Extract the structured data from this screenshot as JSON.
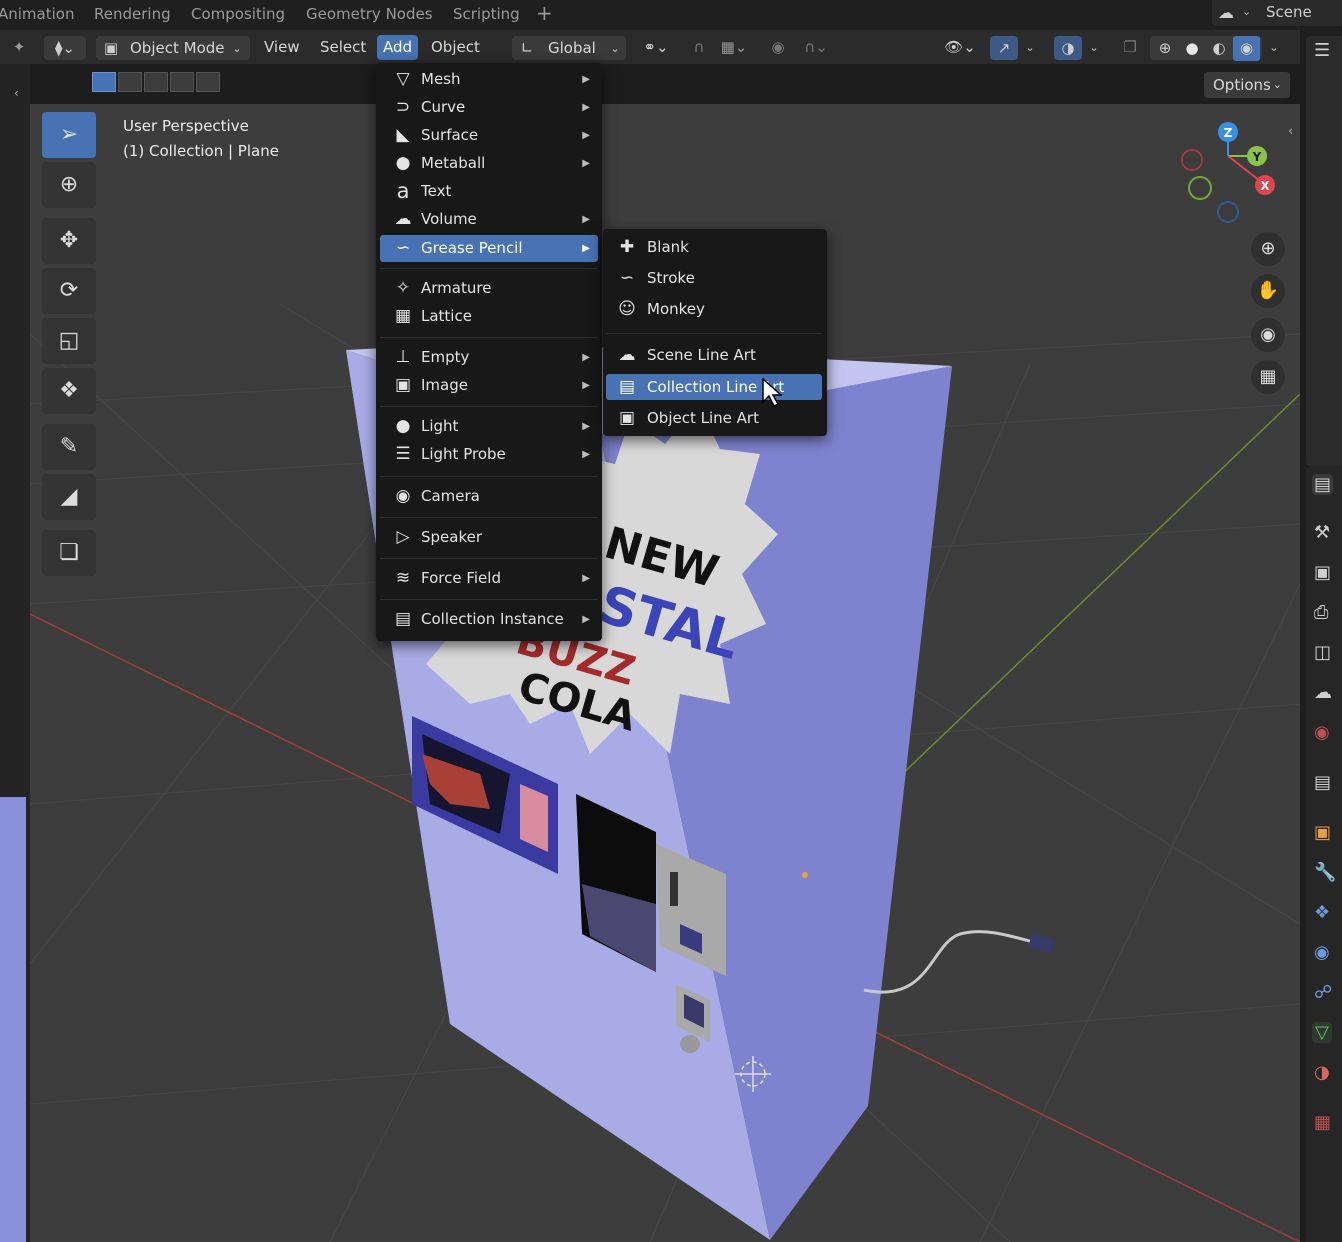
{
  "workspace_tabs": [
    "Animation",
    "Rendering",
    "Compositing",
    "Geometry Nodes",
    "Scripting"
  ],
  "add_tab_symbol": "+",
  "scene": {
    "label": "Scene",
    "icon": "scene-icon"
  },
  "header": {
    "mode": "Object Mode",
    "menus": {
      "view": "View",
      "select": "Select",
      "add": "Add",
      "object": "Object"
    },
    "transform_orientation": "Global"
  },
  "options_label": "Options",
  "viewport_info": {
    "perspective": "User Perspective",
    "collection": "(1) Collection | Plane"
  },
  "gizmo": {
    "x": "X",
    "y": "Y",
    "z": "Z"
  },
  "add_menu": {
    "items": [
      {
        "label": "Mesh",
        "icon": "mesh-icon",
        "submenu": true
      },
      {
        "label": "Curve",
        "icon": "curve-icon",
        "submenu": true
      },
      {
        "label": "Surface",
        "icon": "surface-icon",
        "submenu": true
      },
      {
        "label": "Metaball",
        "icon": "metaball-icon",
        "submenu": true
      },
      {
        "label": "Text",
        "icon": "text-icon",
        "submenu": false
      },
      {
        "label": "Volume",
        "icon": "volume-icon",
        "submenu": true
      },
      {
        "label": "Grease Pencil",
        "icon": "grease-pencil-icon",
        "submenu": true,
        "highlighted": true
      },
      {
        "label": "Armature",
        "icon": "armature-icon",
        "submenu": false
      },
      {
        "label": "Lattice",
        "icon": "lattice-icon",
        "submenu": false
      },
      {
        "label": "Empty",
        "icon": "empty-icon",
        "submenu": true
      },
      {
        "label": "Image",
        "icon": "image-icon",
        "submenu": true
      },
      {
        "label": "Light",
        "icon": "light-icon",
        "submenu": true
      },
      {
        "label": "Light Probe",
        "icon": "light-probe-icon",
        "submenu": true
      },
      {
        "label": "Camera",
        "icon": "camera-icon",
        "submenu": false
      },
      {
        "label": "Speaker",
        "icon": "speaker-icon",
        "submenu": false
      },
      {
        "label": "Force Field",
        "icon": "force-field-icon",
        "submenu": true
      },
      {
        "label": "Collection Instance",
        "icon": "collection-instance-icon",
        "submenu": true
      }
    ]
  },
  "grease_pencil_submenu": {
    "items": [
      {
        "label": "Blank",
        "icon": "blank-icon"
      },
      {
        "label": "Stroke",
        "icon": "stroke-icon"
      },
      {
        "label": "Monkey",
        "icon": "monkey-icon"
      },
      {
        "label": "Scene Line Art",
        "icon": "scene-line-art-icon"
      },
      {
        "label": "Collection Line Art",
        "icon": "collection-line-art-icon",
        "highlighted": true
      },
      {
        "label": "Object Line Art",
        "icon": "object-line-art-icon"
      }
    ]
  },
  "scene_object": {
    "poster_lines": [
      "NEW",
      "STAL",
      "BUZZ",
      "COLA"
    ],
    "colors": {
      "body": "#a8abe6",
      "side": "#7d81cf",
      "poster": "#d6d6d6",
      "blue_text": "#3b44b8",
      "red_text": "#a52a2a"
    }
  },
  "colors": {
    "accent": "#4772b3",
    "menu_bg": "#181818",
    "header_bg": "#2b2b2b",
    "viewport_bg": "#3d3d3d",
    "axis_x": "#e0444d",
    "axis_y": "#8bc34a",
    "axis_z": "#3b8ee0"
  }
}
